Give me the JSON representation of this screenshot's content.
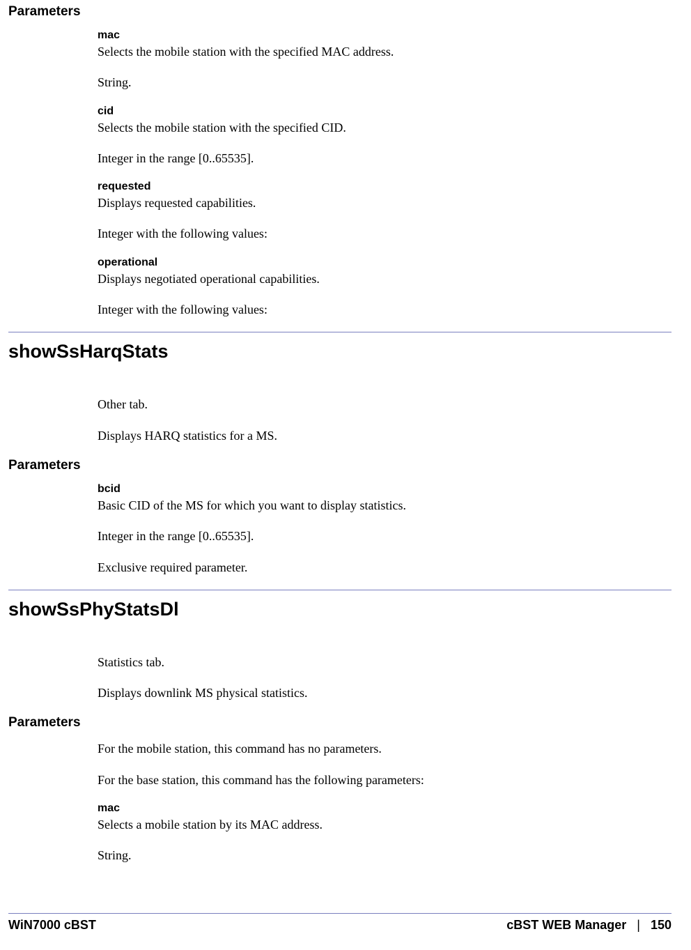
{
  "s1": {
    "heading": "Parameters",
    "params": [
      {
        "name": "mac",
        "lines": [
          "Selects the mobile station with the specified MAC address.",
          "String."
        ]
      },
      {
        "name": "cid",
        "lines": [
          "Selects the mobile station with the specified CID.",
          "Integer in the range [0..65535]."
        ]
      },
      {
        "name": "requested",
        "lines": [
          "Displays requested capabilities.",
          "Integer with the following values:"
        ]
      },
      {
        "name": "operational",
        "lines": [
          "Displays negotiated operational capabilities.",
          "Integer with the following values:"
        ]
      }
    ]
  },
  "s2": {
    "command": "showSsHarqStats",
    "intro": [
      "Other tab.",
      "Displays HARQ statistics for a MS."
    ],
    "heading": "Parameters",
    "params": [
      {
        "name": "bcid",
        "lines": [
          "Basic CID of the MS for which you want to display statistics.",
          "Integer in the range [0..65535].",
          "Exclusive required parameter."
        ]
      }
    ]
  },
  "s3": {
    "command": "showSsPhyStatsDl",
    "intro": [
      "Statistics tab.",
      "Displays downlink MS physical statistics."
    ],
    "heading": "Parameters",
    "prelines": [
      "For the mobile station, this command has no parameters.",
      "For the base station, this command has the following parameters:"
    ],
    "params": [
      {
        "name": "mac",
        "lines": [
          "Selects a mobile station by its MAC address.",
          "String."
        ]
      }
    ]
  },
  "footer": {
    "left": "WiN7000 cBST",
    "right_title": "cBST WEB Manager",
    "sep": "|",
    "page": "150"
  }
}
